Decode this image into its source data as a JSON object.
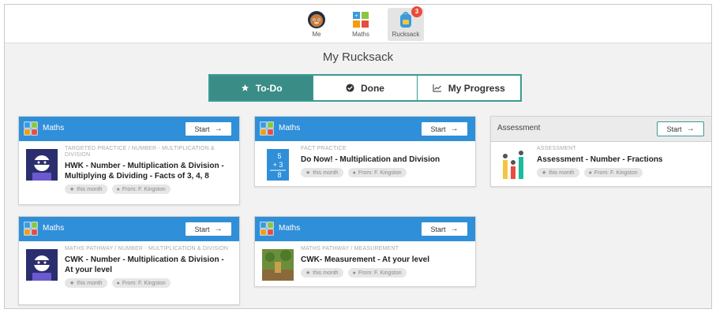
{
  "nav": {
    "me": "Me",
    "maths": "Maths",
    "rucksack": "Rucksack",
    "rucksack_badge": "3"
  },
  "page_title": "My Rucksack",
  "tabs": {
    "todo": "To-Do",
    "done": "Done",
    "progress": "My Progress"
  },
  "cards": [
    {
      "subject": "Maths",
      "start": "Start",
      "category": "TARGETED PRACTICE / NUMBER - MULTIPLICATION & DIVISION",
      "title": "HWK - Number - Multiplication & Division - Multiplying & Dividing - Facts of 3, 4, 8",
      "when": "this month",
      "from": "From: F. Kingston"
    },
    {
      "subject": "Maths",
      "start": "Start",
      "category": "FACT PRACTICE",
      "title": "Do Now! - Multiplication and Division",
      "when": "this month",
      "from": "From: F. Kingston",
      "thumb_digits": [
        "5",
        "+ 3",
        "8"
      ]
    },
    {
      "subject": "Assessment",
      "start": "Start",
      "category": "ASSESSMENT",
      "title": "Assessment - Number - Fractions",
      "when": "this month",
      "from": "From: F. Kingston"
    },
    {
      "subject": "Maths",
      "start": "Start",
      "category": "MATHS PATHWAY / NUMBER - MULTIPLICATION & DIVISION",
      "title": "CWK - Number - Multiplication & Division - At your level",
      "when": "this month",
      "from": "From: F. Kingston"
    },
    {
      "subject": "Maths",
      "start": "Start",
      "category": "MATHS PATHWAY / MEASUREMENT",
      "title": "CWK- Measurement - At your level",
      "when": "this month",
      "from": "From: F. Kingston"
    }
  ],
  "colors": {
    "card_header": "#2f8fd8",
    "tab_active": "#3a8d86",
    "badge": "#e74c3c"
  }
}
